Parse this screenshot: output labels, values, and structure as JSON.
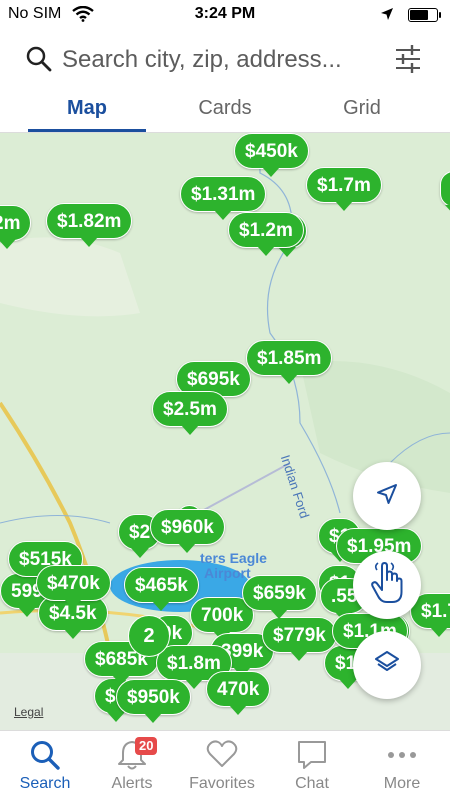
{
  "status_bar": {
    "carrier": "No SIM",
    "time": "3:24 PM"
  },
  "search": {
    "placeholder": "Search city, zip, address..."
  },
  "tabs": [
    {
      "label": "Map"
    },
    {
      "label": "Cards"
    },
    {
      "label": "Grid"
    }
  ],
  "map": {
    "road_label": "Indian Ford",
    "airport_label_1": "ters Eagle",
    "airport_label_2": "Airport",
    "legal": "Legal",
    "cluster_count": "2",
    "pins": [
      "$450k",
      "$1.31m",
      "$1.7m",
      "$1.82m",
      "m",
      "$1.2m",
      "2m",
      "$695k",
      "$1.85m",
      "$2.5m",
      "$960k",
      "$2",
      "$1.95m",
      "$515k",
      "$470k",
      "$465k",
      "599",
      "$4.5k",
      "700k",
      "$659k",
      "$779k",
      "$1.1m",
      "$1.7",
      "$685k",
      "$1.8m",
      "399k",
      "$1.",
      "$950k",
      "470k",
      "$1",
      "$1",
      ".55",
      "0k",
      "$1"
    ]
  },
  "nav": {
    "items": [
      {
        "label": "Search"
      },
      {
        "label": "Alerts"
      },
      {
        "label": "Favorites"
      },
      {
        "label": "Chat"
      },
      {
        "label": "More"
      }
    ],
    "alerts_badge": "20"
  },
  "colors": {
    "accent": "#1b4f9e",
    "pin_green": "#2db32d",
    "map_bg": "#d9ecd3"
  }
}
